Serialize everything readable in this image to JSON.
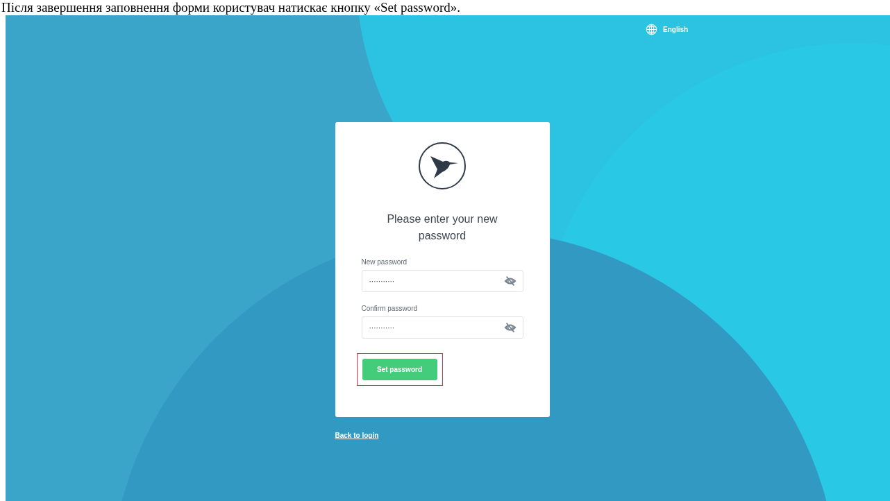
{
  "caption": "Після завершення заповнення форми користувач натискає кнопку «Set password».",
  "language": {
    "label": "English"
  },
  "form": {
    "title": "Please enter your new password",
    "fields": [
      {
        "label": "New password",
        "value": "···········"
      },
      {
        "label": "Confirm password",
        "value": "···········"
      }
    ],
    "submit": {
      "label": "Set password",
      "highlighted": true
    }
  },
  "back_link": "Back to login"
}
